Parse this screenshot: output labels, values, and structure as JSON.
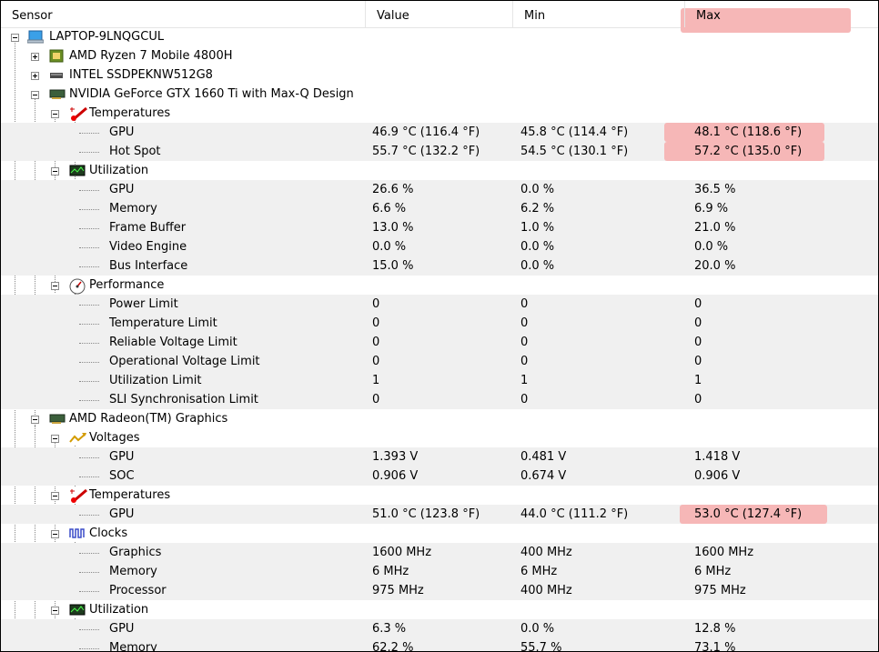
{
  "columns": {
    "sensor": "Sensor",
    "value": "Value",
    "min": "Min",
    "max": "Max"
  },
  "rows": [
    {
      "level": 0,
      "expander": "minus",
      "icon": "laptop-icon",
      "label": "LAPTOP-9LNQGCUL",
      "value": "",
      "min": "",
      "max": ""
    },
    {
      "level": 1,
      "expander": "plus",
      "icon": "cpu-chip-icon",
      "label": "AMD Ryzen 7 Mobile 4800H",
      "value": "",
      "min": "",
      "max": ""
    },
    {
      "level": 1,
      "expander": "plus",
      "icon": "ssd-drive-icon",
      "label": "INTEL SSDPEKNW512G8",
      "value": "",
      "min": "",
      "max": ""
    },
    {
      "level": 1,
      "expander": "minus",
      "icon": "graphics-card-icon",
      "label": "NVIDIA GeForce GTX 1660 Ti with Max-Q Design",
      "value": "",
      "min": "",
      "max": ""
    },
    {
      "level": 2,
      "expander": "minus",
      "icon": "thermometer-icon",
      "label": "Temperatures",
      "value": "",
      "min": "",
      "max": ""
    },
    {
      "level": 3,
      "label": "GPU",
      "value": "46.9 °C  (116.4 °F)",
      "min": "45.8 °C  (114.4 °F)",
      "max": "48.1 °C  (118.6 °F)",
      "highlight": true
    },
    {
      "level": 3,
      "label": "Hot Spot",
      "value": "55.7 °C  (132.2 °F)",
      "min": "54.5 °C  (130.1 °F)",
      "max": "57.2 °C  (135.0 °F)",
      "highlight": true
    },
    {
      "level": 2,
      "expander": "minus",
      "icon": "utilization-monitor-icon",
      "label": "Utilization",
      "value": "",
      "min": "",
      "max": ""
    },
    {
      "level": 3,
      "label": "GPU",
      "value": "26.6 %",
      "min": "0.0 %",
      "max": "36.5 %"
    },
    {
      "level": 3,
      "label": "Memory",
      "value": "6.6 %",
      "min": "6.2 %",
      "max": "6.9 %"
    },
    {
      "level": 3,
      "label": "Frame Buffer",
      "value": "13.0 %",
      "min": "1.0 %",
      "max": "21.0 %"
    },
    {
      "level": 3,
      "label": "Video Engine",
      "value": "0.0 %",
      "min": "0.0 %",
      "max": "0.0 %"
    },
    {
      "level": 3,
      "label": "Bus Interface",
      "value": "15.0 %",
      "min": "0.0 %",
      "max": "20.0 %"
    },
    {
      "level": 2,
      "expander": "minus",
      "icon": "gauge-icon",
      "label": "Performance",
      "value": "",
      "min": "",
      "max": ""
    },
    {
      "level": 3,
      "label": "Power Limit",
      "value": "0",
      "min": "0",
      "max": "0"
    },
    {
      "level": 3,
      "label": "Temperature Limit",
      "value": "0",
      "min": "0",
      "max": "0"
    },
    {
      "level": 3,
      "label": "Reliable Voltage Limit",
      "value": "0",
      "min": "0",
      "max": "0"
    },
    {
      "level": 3,
      "label": "Operational Voltage Limit",
      "value": "0",
      "min": "0",
      "max": "0"
    },
    {
      "level": 3,
      "label": "Utilization Limit",
      "value": "1",
      "min": "1",
      "max": "1"
    },
    {
      "level": 3,
      "label": "SLI Synchronisation Limit",
      "value": "0",
      "min": "0",
      "max": "0"
    },
    {
      "level": 1,
      "expander": "minus",
      "icon": "graphics-card-icon",
      "label": "AMD Radeon(TM) Graphics",
      "value": "",
      "min": "",
      "max": ""
    },
    {
      "level": 2,
      "expander": "minus",
      "icon": "voltage-icon",
      "label": "Voltages",
      "value": "",
      "min": "",
      "max": ""
    },
    {
      "level": 3,
      "label": "GPU",
      "value": "1.393 V",
      "min": "0.481 V",
      "max": "1.418 V"
    },
    {
      "level": 3,
      "label": "SOC",
      "value": "0.906 V",
      "min": "0.674 V",
      "max": "0.906 V"
    },
    {
      "level": 2,
      "expander": "minus",
      "icon": "thermometer-icon",
      "label": "Temperatures",
      "value": "",
      "min": "",
      "max": ""
    },
    {
      "level": 3,
      "label": "GPU",
      "value": "51.0 °C  (123.8 °F)",
      "min": "44.0 °C  (111.2 °F)",
      "max": "53.0 °C  (127.4 °F)",
      "highlight": true
    },
    {
      "level": 2,
      "expander": "minus",
      "icon": "clock-signal-icon",
      "label": "Clocks",
      "value": "",
      "min": "",
      "max": ""
    },
    {
      "level": 3,
      "label": "Graphics",
      "value": "1600 MHz",
      "min": "400 MHz",
      "max": "1600 MHz"
    },
    {
      "level": 3,
      "label": "Memory",
      "value": "6 MHz",
      "min": "6 MHz",
      "max": "6 MHz"
    },
    {
      "level": 3,
      "label": "Processor",
      "value": "975 MHz",
      "min": "400 MHz",
      "max": "975 MHz"
    },
    {
      "level": 2,
      "expander": "minus",
      "icon": "utilization-monitor-icon",
      "label": "Utilization",
      "value": "",
      "min": "",
      "max": ""
    },
    {
      "level": 3,
      "label": "GPU",
      "value": "6.3 %",
      "min": "0.0 %",
      "max": "12.8 %"
    },
    {
      "level": 3,
      "label": "Memory",
      "value": "62.2 %",
      "min": "55.7 %",
      "max": "73.1 %"
    }
  ],
  "colors": {
    "highlight": "#f6b7b7",
    "alt_row": "#f0f0f0"
  }
}
